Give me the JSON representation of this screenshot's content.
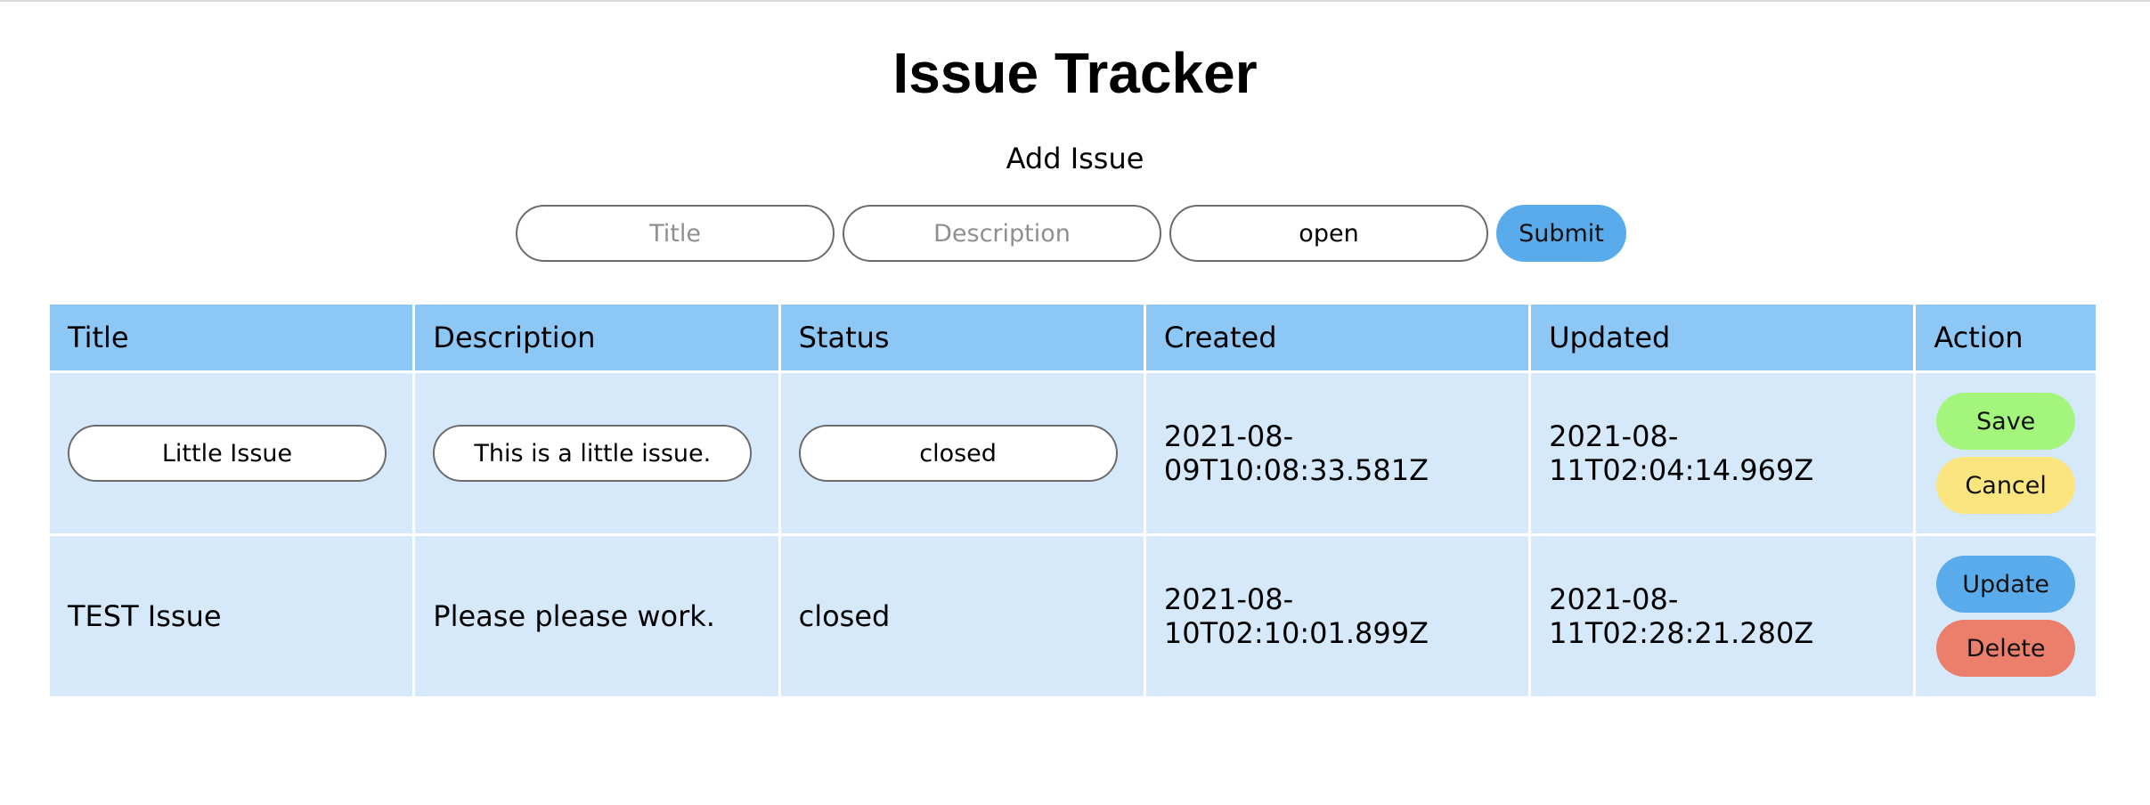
{
  "title": "Issue Tracker",
  "add_form": {
    "heading": "Add Issue",
    "title_placeholder": "Title",
    "description_placeholder": "Description",
    "status_value": "open",
    "submit_label": "Submit"
  },
  "table": {
    "headers": [
      "Title",
      "Description",
      "Status",
      "Created",
      "Updated",
      "Action"
    ],
    "rows": [
      {
        "mode": "editing",
        "title": "Little Issue",
        "description": "This is a little issue.",
        "status": "closed",
        "created": "2021-08-09T10:08:33.581Z",
        "updated": "2021-08-11T02:04:14.969Z",
        "actions": [
          "Save",
          "Cancel"
        ]
      },
      {
        "mode": "display",
        "title": "TEST Issue",
        "description": "Please please work.",
        "status": "closed",
        "created": "2021-08-10T02:10:01.899Z",
        "updated": "2021-08-11T02:28:21.280Z",
        "actions": [
          "Update",
          "Delete"
        ]
      }
    ]
  },
  "colors": {
    "header_bg": "#8cc7f5",
    "row_bg": "#d5e9fa",
    "submit_button": "#5aabec",
    "save_button": "#a3f57c",
    "cancel_button": "#fae57f",
    "update_button": "#5aabec",
    "delete_button": "#ec7f6c"
  }
}
